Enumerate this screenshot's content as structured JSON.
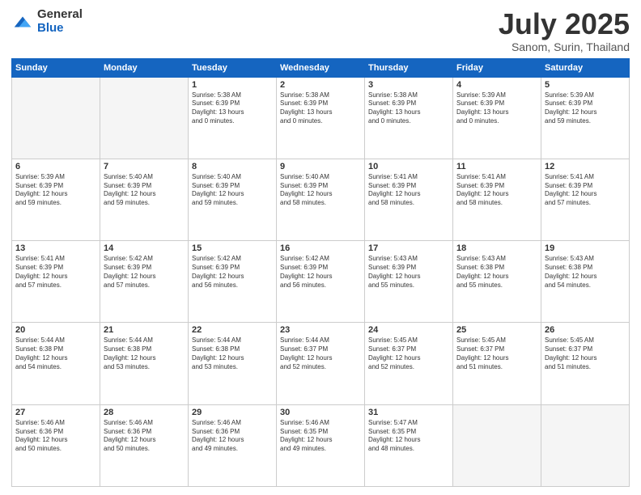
{
  "header": {
    "logo_general": "General",
    "logo_blue": "Blue",
    "title": "July 2025",
    "location": "Sanom, Surin, Thailand"
  },
  "days_of_week": [
    "Sunday",
    "Monday",
    "Tuesday",
    "Wednesday",
    "Thursday",
    "Friday",
    "Saturday"
  ],
  "weeks": [
    [
      {
        "day": "",
        "empty": true
      },
      {
        "day": "",
        "empty": true
      },
      {
        "day": "1",
        "sunrise": "5:38 AM",
        "sunset": "6:39 PM",
        "daylight": "13 hours and 0 minutes."
      },
      {
        "day": "2",
        "sunrise": "5:38 AM",
        "sunset": "6:39 PM",
        "daylight": "13 hours and 0 minutes."
      },
      {
        "day": "3",
        "sunrise": "5:38 AM",
        "sunset": "6:39 PM",
        "daylight": "13 hours and 0 minutes."
      },
      {
        "day": "4",
        "sunrise": "5:39 AM",
        "sunset": "6:39 PM",
        "daylight": "13 hours and 0 minutes."
      },
      {
        "day": "5",
        "sunrise": "5:39 AM",
        "sunset": "6:39 PM",
        "daylight": "12 hours and 59 minutes."
      }
    ],
    [
      {
        "day": "6",
        "sunrise": "5:39 AM",
        "sunset": "6:39 PM",
        "daylight": "12 hours and 59 minutes."
      },
      {
        "day": "7",
        "sunrise": "5:40 AM",
        "sunset": "6:39 PM",
        "daylight": "12 hours and 59 minutes."
      },
      {
        "day": "8",
        "sunrise": "5:40 AM",
        "sunset": "6:39 PM",
        "daylight": "12 hours and 59 minutes."
      },
      {
        "day": "9",
        "sunrise": "5:40 AM",
        "sunset": "6:39 PM",
        "daylight": "12 hours and 58 minutes."
      },
      {
        "day": "10",
        "sunrise": "5:41 AM",
        "sunset": "6:39 PM",
        "daylight": "12 hours and 58 minutes."
      },
      {
        "day": "11",
        "sunrise": "5:41 AM",
        "sunset": "6:39 PM",
        "daylight": "12 hours and 58 minutes."
      },
      {
        "day": "12",
        "sunrise": "5:41 AM",
        "sunset": "6:39 PM",
        "daylight": "12 hours and 57 minutes."
      }
    ],
    [
      {
        "day": "13",
        "sunrise": "5:41 AM",
        "sunset": "6:39 PM",
        "daylight": "12 hours and 57 minutes."
      },
      {
        "day": "14",
        "sunrise": "5:42 AM",
        "sunset": "6:39 PM",
        "daylight": "12 hours and 57 minutes."
      },
      {
        "day": "15",
        "sunrise": "5:42 AM",
        "sunset": "6:39 PM",
        "daylight": "12 hours and 56 minutes."
      },
      {
        "day": "16",
        "sunrise": "5:42 AM",
        "sunset": "6:39 PM",
        "daylight": "12 hours and 56 minutes."
      },
      {
        "day": "17",
        "sunrise": "5:43 AM",
        "sunset": "6:39 PM",
        "daylight": "12 hours and 55 minutes."
      },
      {
        "day": "18",
        "sunrise": "5:43 AM",
        "sunset": "6:38 PM",
        "daylight": "12 hours and 55 minutes."
      },
      {
        "day": "19",
        "sunrise": "5:43 AM",
        "sunset": "6:38 PM",
        "daylight": "12 hours and 54 minutes."
      }
    ],
    [
      {
        "day": "20",
        "sunrise": "5:44 AM",
        "sunset": "6:38 PM",
        "daylight": "12 hours and 54 minutes."
      },
      {
        "day": "21",
        "sunrise": "5:44 AM",
        "sunset": "6:38 PM",
        "daylight": "12 hours and 53 minutes."
      },
      {
        "day": "22",
        "sunrise": "5:44 AM",
        "sunset": "6:38 PM",
        "daylight": "12 hours and 53 minutes."
      },
      {
        "day": "23",
        "sunrise": "5:44 AM",
        "sunset": "6:37 PM",
        "daylight": "12 hours and 52 minutes."
      },
      {
        "day": "24",
        "sunrise": "5:45 AM",
        "sunset": "6:37 PM",
        "daylight": "12 hours and 52 minutes."
      },
      {
        "day": "25",
        "sunrise": "5:45 AM",
        "sunset": "6:37 PM",
        "daylight": "12 hours and 51 minutes."
      },
      {
        "day": "26",
        "sunrise": "5:45 AM",
        "sunset": "6:37 PM",
        "daylight": "12 hours and 51 minutes."
      }
    ],
    [
      {
        "day": "27",
        "sunrise": "5:46 AM",
        "sunset": "6:36 PM",
        "daylight": "12 hours and 50 minutes."
      },
      {
        "day": "28",
        "sunrise": "5:46 AM",
        "sunset": "6:36 PM",
        "daylight": "12 hours and 50 minutes."
      },
      {
        "day": "29",
        "sunrise": "5:46 AM",
        "sunset": "6:36 PM",
        "daylight": "12 hours and 49 minutes."
      },
      {
        "day": "30",
        "sunrise": "5:46 AM",
        "sunset": "6:35 PM",
        "daylight": "12 hours and 49 minutes."
      },
      {
        "day": "31",
        "sunrise": "5:47 AM",
        "sunset": "6:35 PM",
        "daylight": "12 hours and 48 minutes."
      },
      {
        "day": "",
        "empty": true
      },
      {
        "day": "",
        "empty": true
      }
    ]
  ],
  "labels": {
    "sunrise": "Sunrise:",
    "sunset": "Sunset:",
    "daylight": "Daylight:"
  }
}
